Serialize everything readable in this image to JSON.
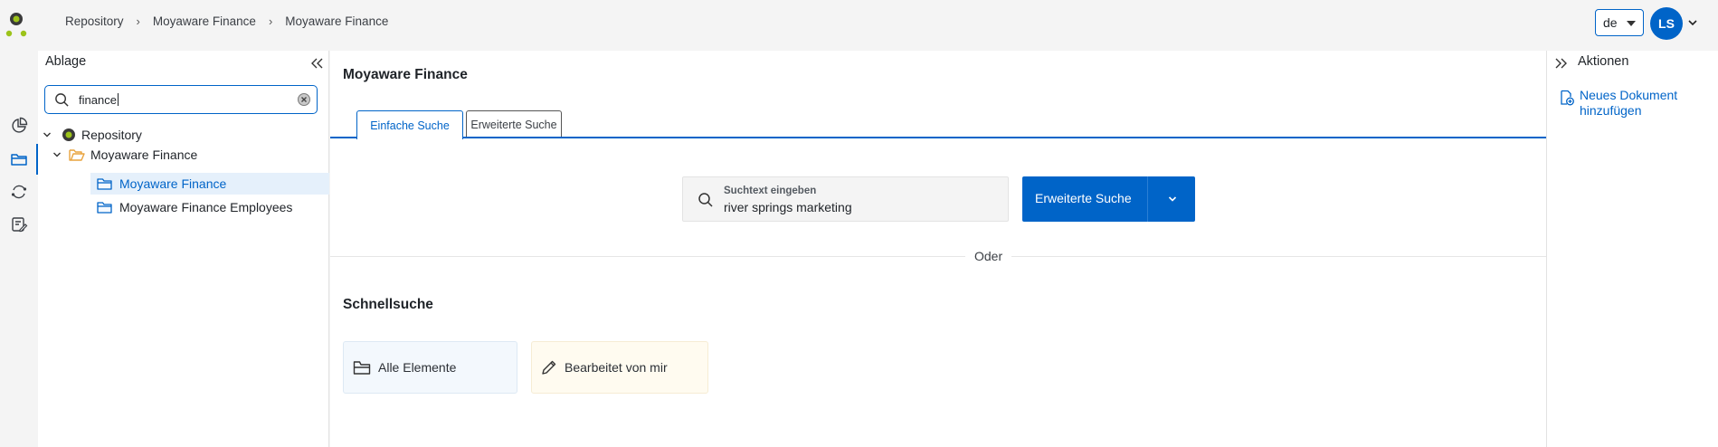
{
  "breadcrumb": [
    "Repository",
    "Moyaware Finance",
    "Moyaware Finance"
  ],
  "header": {
    "language": "de",
    "user_initials": "LS"
  },
  "rail": {
    "items": [
      "chart-icon",
      "folder-icon",
      "sync-icon",
      "tasks-icon"
    ],
    "active": "folder-icon"
  },
  "sidebar": {
    "title": "Ablage",
    "search_value": "finance",
    "tree": [
      {
        "label": "Repository",
        "icon": "repository-icon",
        "level": 0,
        "expanded": true
      },
      {
        "label": "Moyaware Finance",
        "icon": "folder-open-icon",
        "level": 1,
        "expanded": true
      },
      {
        "label": "Moyaware Finance",
        "icon": "folder-icon",
        "level": 2,
        "selected": true
      },
      {
        "label": "Moyaware Finance Employees",
        "icon": "folder-icon",
        "level": 2
      }
    ]
  },
  "main": {
    "title": "Moyaware Finance",
    "tabs": [
      {
        "label": "Einfache Suche",
        "active": true
      },
      {
        "label": "Erweiterte Suche",
        "active": false
      }
    ],
    "search": {
      "placeholder": "Suchtext eingeben",
      "value": "river springs marketing"
    },
    "advanced_button": "Erweiterte Suche",
    "or_text": "Oder",
    "quick_search_title": "Schnellsuche",
    "quick_items": [
      {
        "label": "Alle Elemente",
        "icon": "folder-icon"
      },
      {
        "label": "Bearbeitet von mir",
        "icon": "pencil-icon"
      }
    ]
  },
  "actions": {
    "title": "Aktionen",
    "items": [
      {
        "label_line1": "Neues Dokument",
        "label_line2": "hinzufügen",
        "icon": "add-document-icon"
      }
    ]
  },
  "colors": {
    "accent": "#0064c8",
    "selected_bg": "#e5f0fb",
    "logo_green": "#9cc31a"
  }
}
